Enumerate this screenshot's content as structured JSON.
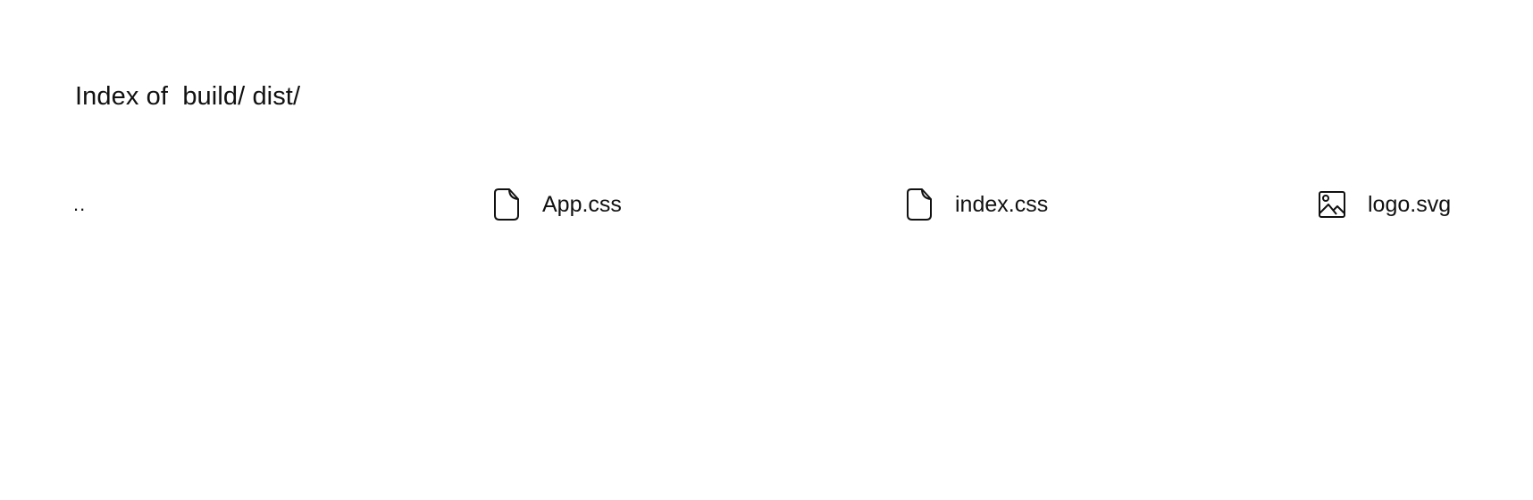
{
  "heading": {
    "prefix": "Index of ",
    "path_segments": [
      "build/",
      "dist/"
    ]
  },
  "entries": [
    {
      "name": "..",
      "icon": "none",
      "kind": "parent-directory"
    },
    {
      "name": "App.css",
      "icon": "file-icon",
      "kind": "file"
    },
    {
      "name": "index.css",
      "icon": "file-icon",
      "kind": "file"
    },
    {
      "name": "logo.svg",
      "icon": "image-icon",
      "kind": "image"
    }
  ]
}
